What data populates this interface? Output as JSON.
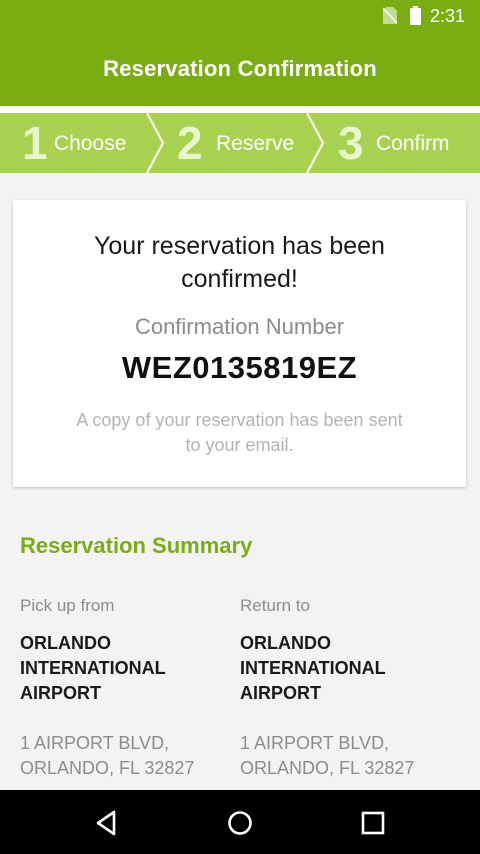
{
  "status": {
    "time": "2:31",
    "icons": [
      "no-sim-icon",
      "battery-icon"
    ]
  },
  "appbar": {
    "title": "Reservation Confirmation"
  },
  "colors": {
    "primary": "#7aad12",
    "stepper_bg": "#a8d14f",
    "background": "#f3f3f3"
  },
  "stepper": {
    "steps": [
      {
        "number": "1",
        "label": "Choose"
      },
      {
        "number": "2",
        "label": "Reserve"
      },
      {
        "number": "3",
        "label": "Confirm"
      }
    ],
    "current": 3
  },
  "card": {
    "headline_line1": "Your reservation has been",
    "headline_line2": "confirmed!",
    "confirmation_label": "Confirmation Number",
    "confirmation_number": "WEZ0135819EZ",
    "note_line1": "A copy of your reservation has been sent",
    "note_line2": "to your email."
  },
  "summary": {
    "title": "Reservation Summary",
    "pickup": {
      "label": "Pick up from",
      "location_line1": "ORLANDO",
      "location_line2": "INTERNATIONAL",
      "location_line3": "AIRPORT",
      "address_line1": "1 AIRPORT BLVD,",
      "address_line2": "ORLANDO, FL 32827"
    },
    "return": {
      "label": "Return to",
      "location_line1": "ORLANDO",
      "location_line2": "INTERNATIONAL",
      "location_line3": "AIRPORT",
      "address_line1": "1 AIRPORT BLVD,",
      "address_line2": "ORLANDO, FL 32827"
    }
  },
  "navbar": {
    "buttons": [
      "back-icon",
      "home-icon",
      "recents-icon"
    ]
  }
}
